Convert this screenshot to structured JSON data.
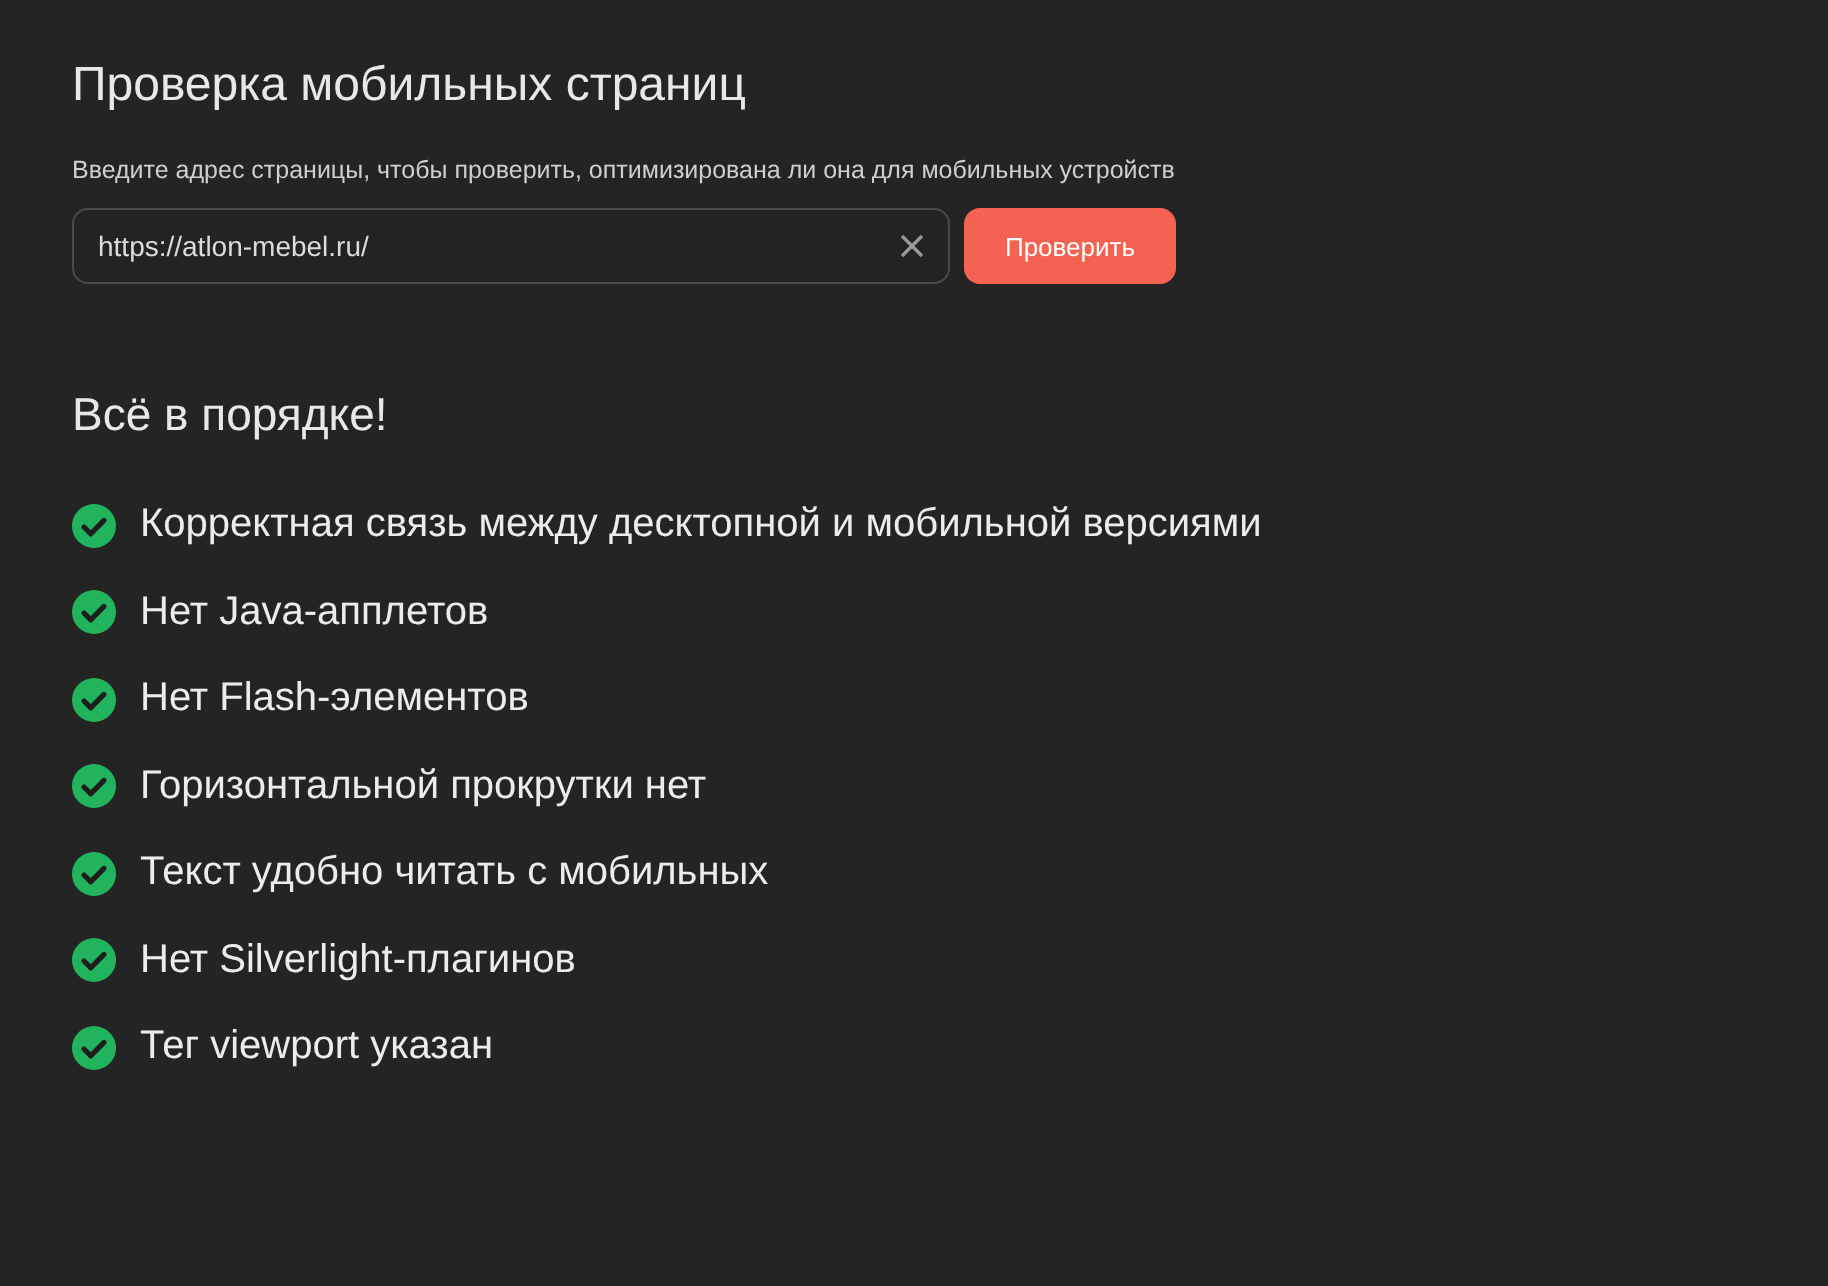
{
  "title": "Проверка мобильных страниц",
  "subtitle": "Введите адрес страницы, чтобы проверить, оптимизирована ли она для мобильных устройств",
  "url_field": {
    "value": "https://atlon-mebel.ru/"
  },
  "check_button": "Проверить",
  "result_heading": "Всё в порядке!",
  "checks": [
    {
      "kind": "pass",
      "label": "Корректная связь между десктопной и мобильной версиями"
    },
    {
      "kind": "pass",
      "label": "Нет Java-апплетов"
    },
    {
      "kind": "pass",
      "label": "Нет Flash-элементов"
    },
    {
      "kind": "pass",
      "label": "Горизонтальной прокрутки нет"
    },
    {
      "kind": "pass",
      "label": "Текст удобно читать с мобильных"
    },
    {
      "kind": "pass",
      "label": "Нет Silverlight-плагинов"
    },
    {
      "kind": "pass",
      "label": "Тег viewport указан"
    }
  ]
}
